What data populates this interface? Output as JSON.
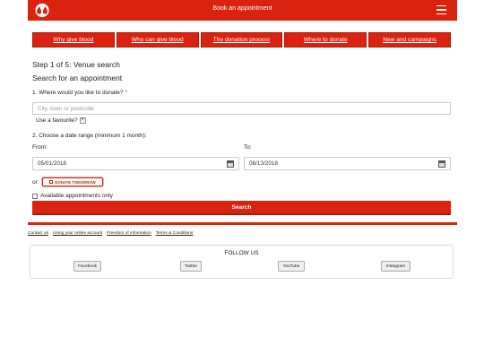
{
  "header": {
    "title": "Book an appointment"
  },
  "nav": [
    {
      "label": "Why give blood"
    },
    {
      "label": "Who can give blood"
    },
    {
      "label": "The donation process"
    },
    {
      "label": "Where to donate"
    },
    {
      "label": "New and campaigns"
    }
  ],
  "form": {
    "step": "Step 1 of 5: Venue search",
    "heading": "Search for an appointment",
    "q1": "1. Where would you like to donate?",
    "q1_required": "*",
    "location_placeholder": "City, town or postcode",
    "use_favourite": "Use a favourite?",
    "favourite_button": "+",
    "q2": "2. Choose a date range (minimum 1 month):",
    "from_label": "From:",
    "to_label": "To:",
    "from_value": "05/01/2018",
    "to_value": "08/13/2018",
    "or_text": "or",
    "tomorrow_label": "DONATE TOMORROW",
    "available_only": "Available appointments only",
    "search_label": "Search"
  },
  "footer": {
    "links": [
      {
        "label": "Contact us"
      },
      {
        "label": "Using your online account"
      },
      {
        "label": "Freedom of information"
      },
      {
        "label": "Terms & Conditions"
      }
    ],
    "follow_title": "FOLLOW US",
    "social": [
      {
        "label": "Facebook"
      },
      {
        "label": "Twitter"
      },
      {
        "label": "YouTube"
      },
      {
        "label": "Instagram"
      }
    ]
  },
  "colors": {
    "brand": "#d9230f",
    "border": "#cccccc"
  },
  "icons": [
    "blood-drop-logo-icon",
    "hamburger-menu-icon",
    "calendar-icon",
    "checkbox-icon"
  ]
}
